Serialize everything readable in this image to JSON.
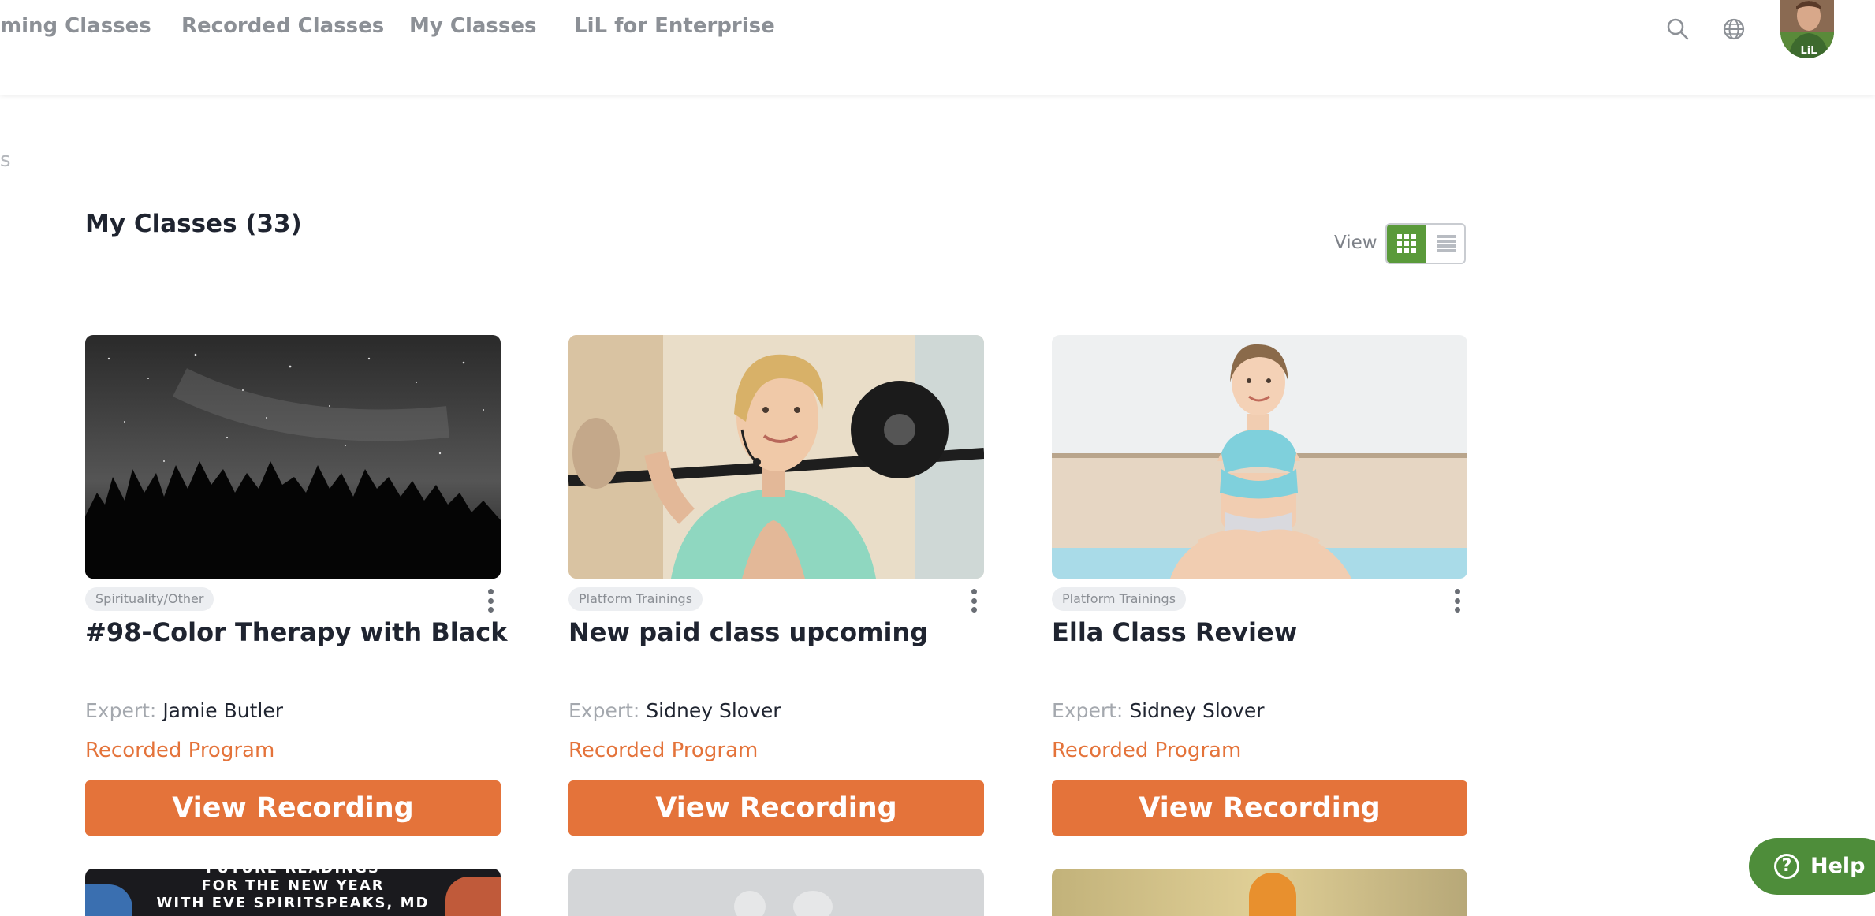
{
  "nav": {
    "items": [
      {
        "label": "ming Classes"
      },
      {
        "label": "Recorded Classes"
      },
      {
        "label": "My Classes"
      },
      {
        "label": "LiL for Enterprise"
      }
    ]
  },
  "header_icons": {
    "search": "search-icon",
    "language": "globe-icon",
    "avatar_badge": "LiL"
  },
  "breadcrumb_fragment": "s",
  "page_title": "My Classes (33)",
  "view": {
    "label": "View",
    "selected": "grid",
    "options": [
      "grid",
      "list"
    ]
  },
  "cards": [
    {
      "category": "Spirituality/Other",
      "title": "#98-Color Therapy with Black",
      "expert_label": "Expert:",
      "expert_name": "Jamie Butler",
      "program_type": "Recorded Program",
      "action_label": "View Recording"
    },
    {
      "category": "Platform Trainings",
      "title": "New paid class upcoming",
      "expert_label": "Expert:",
      "expert_name": "Sidney Slover",
      "program_type": "Recorded Program",
      "action_label": "View Recording"
    },
    {
      "category": "Platform Trainings",
      "title": "Ella Class Review",
      "expert_label": "Expert:",
      "expert_name": "Sidney Slover",
      "program_type": "Recorded Program",
      "action_label": "View Recording"
    }
  ],
  "next_row_first_card_text": {
    "line1": "FUTURE READINGS",
    "line2": "FOR THE NEW YEAR",
    "line3": "WITH EVE SPIRITSPEAKS, MD"
  },
  "help": {
    "label": "Help",
    "icon": "question-icon"
  },
  "colors": {
    "accent_orange": "#e4733a",
    "accent_green": "#5a9a3a",
    "help_green": "#4e8d3a",
    "nav_text": "#8c9096"
  }
}
